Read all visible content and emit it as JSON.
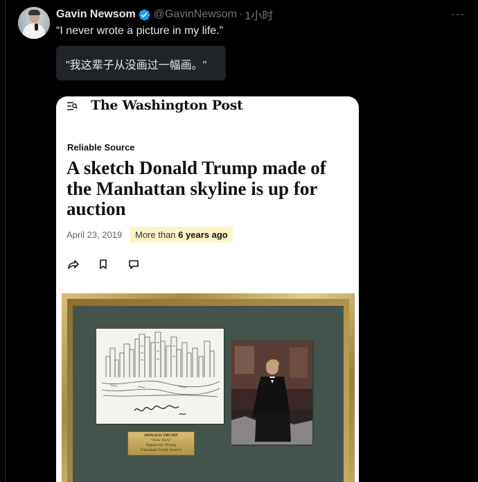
{
  "tweet": {
    "display_name": "Gavin Newsom",
    "handle": "@GavinNewsom",
    "separator": "·",
    "time": "1小时",
    "text": "“I never wrote a picture in my life.”",
    "translation": "\"我这辈子从没画过一幅画。\"",
    "more_icon": "more-icon",
    "verified_icon": "verified-badge-icon",
    "verified_color": "#1d9bf0"
  },
  "article": {
    "menu_icon": "menu-icon",
    "publication": "The Washington Post",
    "section": "Reliable Source",
    "headline": "A sketch Donald Trump made of the Manhattan skyline is up for auction",
    "date": "April 23, 2019",
    "age_prefix": "More than ",
    "age_bold": "6 years ago",
    "actions": [
      "share-icon",
      "bookmark-icon",
      "comment-icon"
    ],
    "highlight_color": "#fcf4c6"
  },
  "image": {
    "plaque_lines": [
      "DONALD TRUMP",
      "\"New York\"",
      "Signed by Trump",
      "Canadian Trade Source"
    ]
  }
}
